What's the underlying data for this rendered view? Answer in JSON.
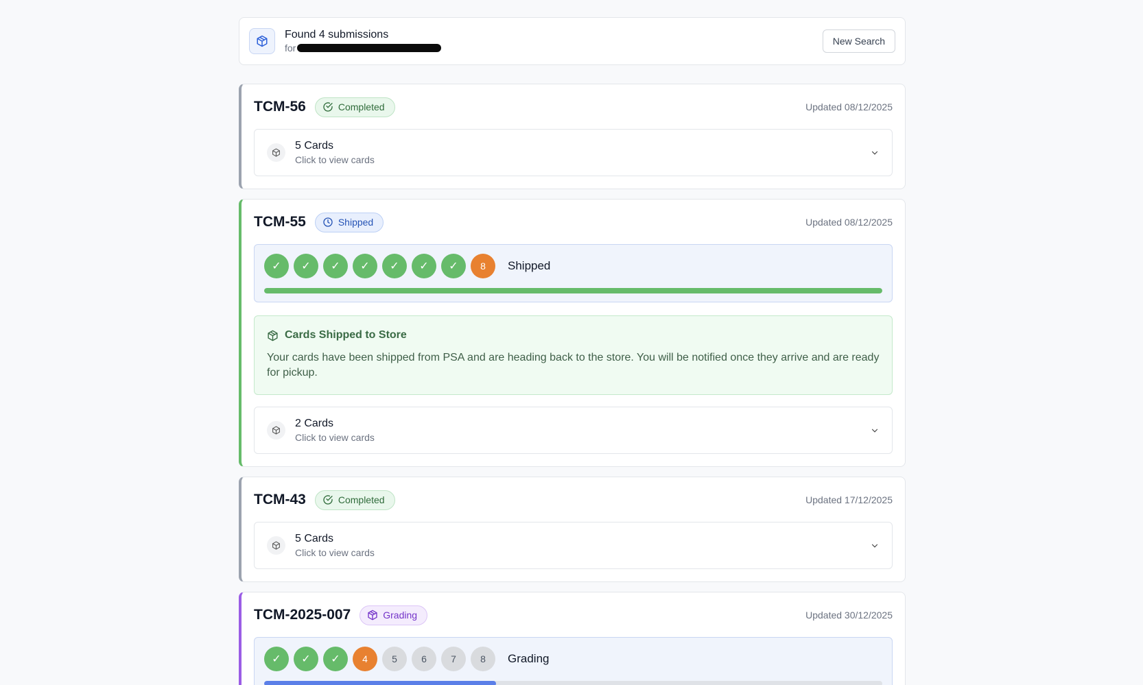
{
  "header": {
    "title": "Found 4 submissions",
    "for_label": "for",
    "new_search_label": "New Search",
    "icon": "package-icon"
  },
  "colors": {
    "done": "#66bb6a",
    "active": "#e88130",
    "pending": "#d9dbde",
    "shipped_bar": "#66bb6a",
    "grading_bar": "#5b7fe8"
  },
  "submissions": [
    {
      "id": "TCM-56",
      "status": "Completed",
      "updated": "Updated 08/12/2025",
      "cards_title": "5 Cards",
      "cards_sub": "Click to view cards"
    },
    {
      "id": "TCM-55",
      "status": "Shipped",
      "updated": "Updated 08/12/2025",
      "progress": {
        "steps": [
          "✓",
          "✓",
          "✓",
          "✓",
          "✓",
          "✓",
          "✓",
          "8"
        ],
        "current_step": 8,
        "label": "Shipped",
        "fraction": 1.0
      },
      "note_title": "Cards Shipped to Store",
      "note_body": "Your cards have been shipped from PSA and are heading back to the store. You will be notified once they arrive and are ready for pickup.",
      "cards_title": "2 Cards",
      "cards_sub": "Click to view cards"
    },
    {
      "id": "TCM-43",
      "status": "Completed",
      "updated": "Updated 17/12/2025",
      "cards_title": "5 Cards",
      "cards_sub": "Click to view cards"
    },
    {
      "id": "TCM-2025-007",
      "status": "Grading",
      "updated": "Updated 30/12/2025",
      "progress": {
        "steps": [
          "✓",
          "✓",
          "✓",
          "4",
          "5",
          "6",
          "7",
          "8"
        ],
        "current_step": 4,
        "label": "Grading",
        "fraction": 0.375
      }
    }
  ]
}
